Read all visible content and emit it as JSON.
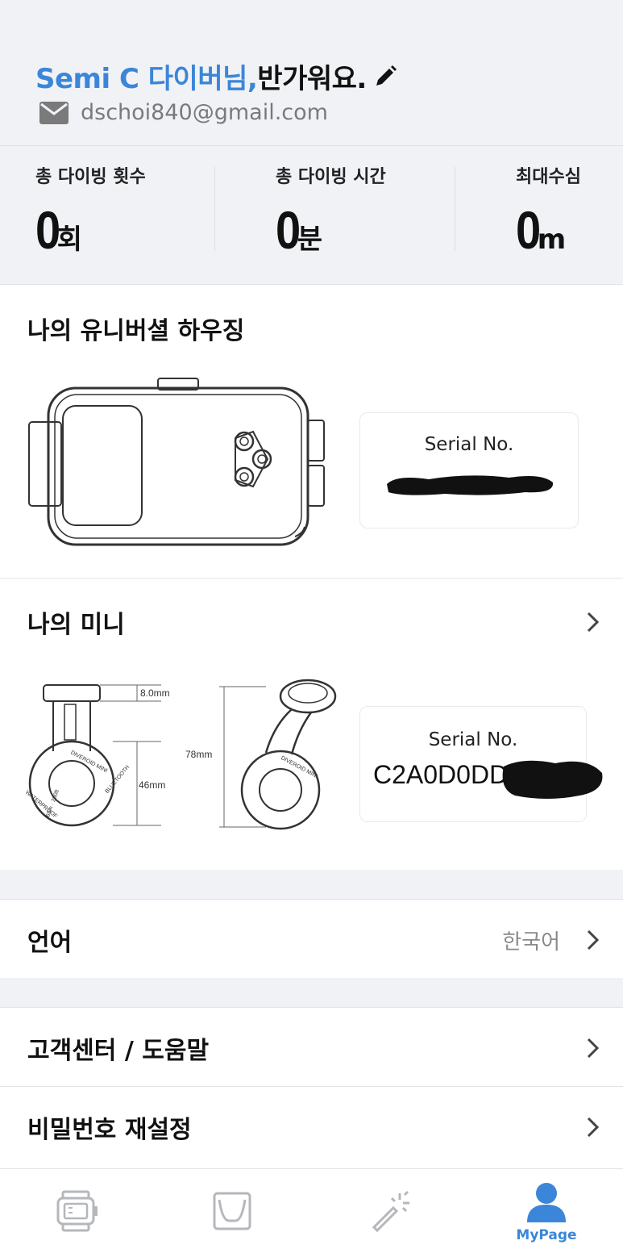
{
  "header": {
    "name": "Semi C 다이버님,",
    "greeting": "반가워요.",
    "email": "dschoi840@gmail.com"
  },
  "stats": [
    {
      "label": "총 다이빙 횟수",
      "value": "0",
      "unit": "회"
    },
    {
      "label": "총 다이빙 시간",
      "value": "0",
      "unit": "분"
    },
    {
      "label": "최대수심",
      "value": "0",
      "unit": "m"
    }
  ],
  "housing": {
    "title": "나의 유니버셜 하우징",
    "serial_label": "Serial No."
  },
  "mini": {
    "title": "나의 미니",
    "serial_label": "Serial No.",
    "serial_value": "C2A0D0DD",
    "device_labels": {
      "dim_top": "8.0mm",
      "dim_height": "78mm",
      "dim_body": "46mm",
      "ring_text": "DIVEROID MINI",
      "ring_text2": "BLUETOOTH",
      "ring_text3": "WATERPROOF",
      "ring_depth": "60m · 200ft"
    }
  },
  "settings": {
    "language_label": "언어",
    "language_value": "한국어",
    "support_label": "고객센터 / 도움말",
    "password_label": "비밀번호 재설정"
  },
  "nav": {
    "mypage_label": "MyPage"
  },
  "colors": {
    "accent": "#3b86d8",
    "background": "#f1f2f6",
    "icon_gray": "#b5b7bc"
  }
}
